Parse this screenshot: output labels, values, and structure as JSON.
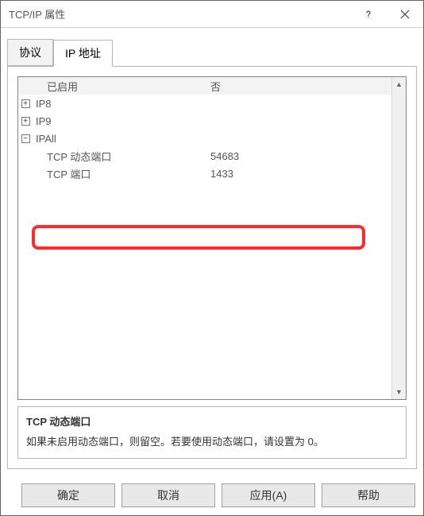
{
  "window": {
    "title": "TCP/IP 属性"
  },
  "tabs": {
    "protocol": "协议",
    "ip": "IP 地址"
  },
  "grid": {
    "enabledRow": {
      "label": "已启用",
      "value": "否"
    },
    "ip8": {
      "label": "IP8"
    },
    "ip9": {
      "label": "IP9"
    },
    "ipall": {
      "label": "IPAll"
    },
    "dynPort": {
      "label": "TCP 动态端口",
      "value": "54683"
    },
    "tcpPort": {
      "label": "TCP 端口",
      "value": "1433"
    }
  },
  "desc": {
    "title": "TCP 动态端口",
    "body": "如果未启用动态端口，则留空。若要使用动态端口，请设置为 0。"
  },
  "buttons": {
    "ok": "确定",
    "cancel": "取消",
    "apply": "应用(A)",
    "help": "帮助"
  },
  "icons": {
    "plus": "+",
    "minus": "−",
    "up": "▲",
    "down": "▼"
  }
}
